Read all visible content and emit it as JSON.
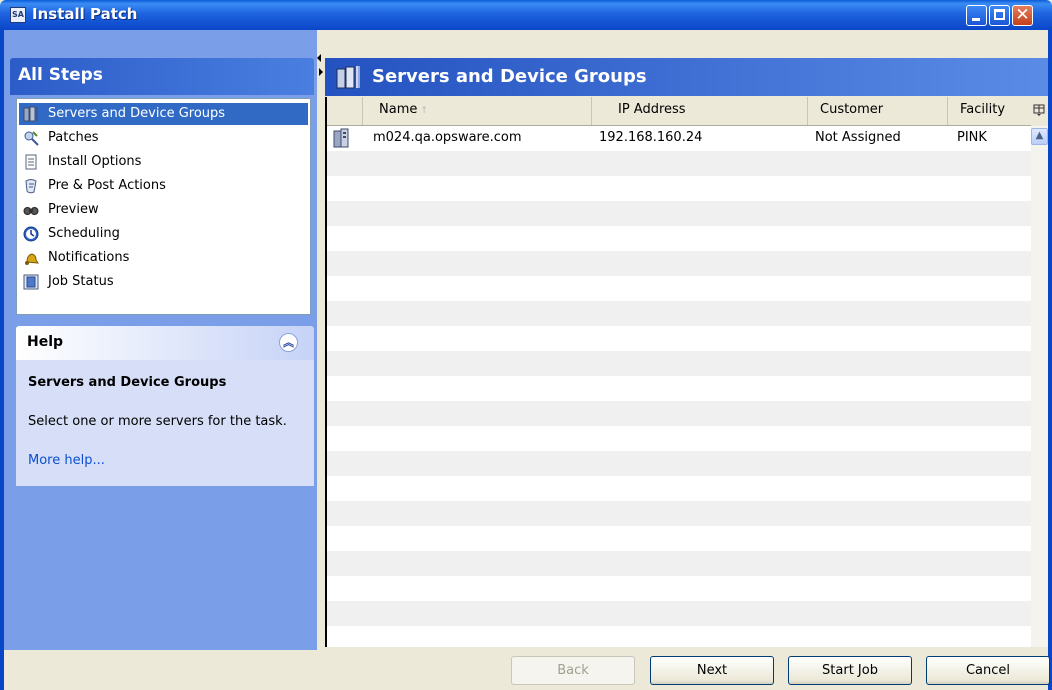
{
  "window": {
    "title": "Install Patch",
    "app_badge": "SA"
  },
  "steps_panel": {
    "title": "All Steps",
    "items": [
      {
        "label": "Servers and Device Groups",
        "icon": "servers-icon",
        "selected": true
      },
      {
        "label": "Patches",
        "icon": "patches-icon",
        "selected": false
      },
      {
        "label": "Install Options",
        "icon": "install-options-icon",
        "selected": false
      },
      {
        "label": "Pre & Post Actions",
        "icon": "actions-icon",
        "selected": false
      },
      {
        "label": "Preview",
        "icon": "preview-icon",
        "selected": false
      },
      {
        "label": "Scheduling",
        "icon": "clock-icon",
        "selected": false
      },
      {
        "label": "Notifications",
        "icon": "bell-icon",
        "selected": false
      },
      {
        "label": "Job Status",
        "icon": "job-status-icon",
        "selected": false
      }
    ]
  },
  "help": {
    "title": "Help",
    "heading": "Servers and Device Groups",
    "text": "Select one or more servers for the task.",
    "link": "More help..."
  },
  "main": {
    "title": "Servers and Device Groups",
    "columns": [
      "Name",
      "IP Address",
      "Customer",
      "Facility"
    ],
    "sort_indicator": "↑",
    "rows": [
      {
        "name": "m024.qa.opsware.com",
        "ip": "192.168.160.24",
        "customer": "Not Assigned",
        "facility": "PINK"
      }
    ]
  },
  "buttons": {
    "back": "Back",
    "next": "Next",
    "start_job": "Start Job",
    "cancel": "Cancel"
  },
  "colors": {
    "title_bar": "#0a46c8",
    "panel_bg": "#7b9ee8",
    "selection": "#316ac5",
    "link": "#0b4fd0"
  }
}
